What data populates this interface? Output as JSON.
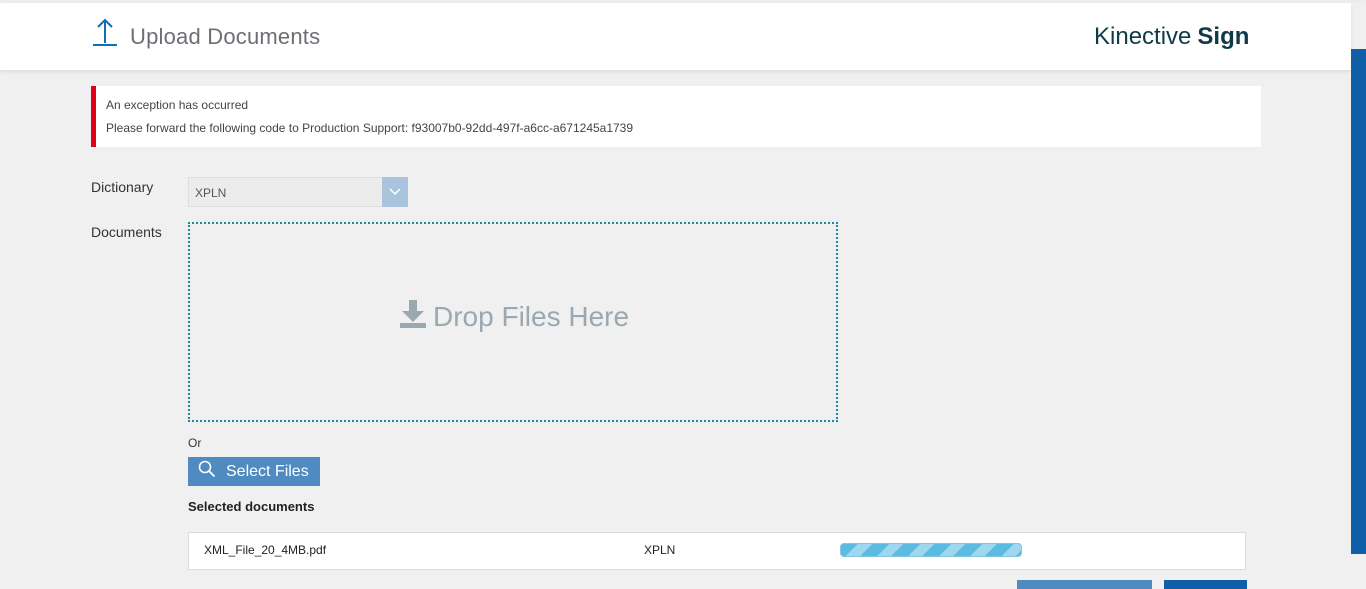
{
  "header": {
    "title": "Upload Documents",
    "icon": "upload-arrow-icon",
    "brand_light": "Kinective",
    "brand_bold": "Sign"
  },
  "alert": {
    "line1": "An exception has occurred",
    "line2": "Please forward the following code to Production Support: f93007b0-92dd-497f-a6cc-a671245a1739",
    "color": "#e2001a"
  },
  "form": {
    "dictionary_label": "Dictionary",
    "dictionary_value": "XPLN",
    "documents_label": "Documents",
    "drop_text": "Drop Files Here",
    "or_text": "Or",
    "select_files_label": "Select Files"
  },
  "selected": {
    "title": "Selected documents",
    "files": [
      {
        "name": "XML_File_20_4MB.pdf",
        "dictionary": "XPLN",
        "progress": "uploading"
      }
    ]
  },
  "colors": {
    "accent": "#4f8bc0",
    "brand": "#0e3a47",
    "scrollbar": "#0f5fa8"
  }
}
